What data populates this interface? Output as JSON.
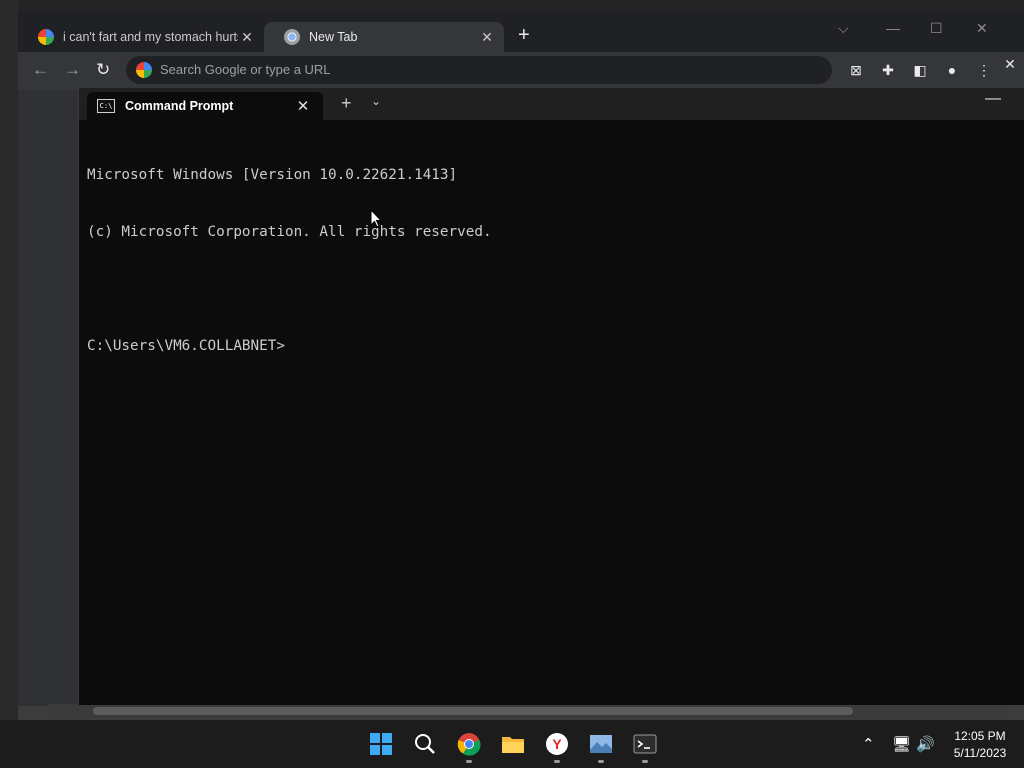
{
  "browser": {
    "tabs": [
      {
        "title": "i can't fart and my stomach hurts",
        "active": false
      },
      {
        "title": "New Tab",
        "active": true
      }
    ],
    "new_tab_symbol": "+",
    "omnibox_placeholder": "Search Google or type a URL"
  },
  "terminal": {
    "tab_title": "Command Prompt",
    "tab_icon_text": "C:\\",
    "lines": [
      "Microsoft Windows [Version 10.0.22621.1413]",
      "(c) Microsoft Corporation. All rights reserved.",
      "",
      "C:\\Users\\VM6.COLLABNET>"
    ]
  },
  "taskbar": {
    "icons": [
      "windows-start-icon",
      "search-icon",
      "chrome-icon",
      "file-explorer-icon",
      "yandex-icon",
      "photos-icon",
      "terminal-icon"
    ],
    "clock_time": "12:05 PM",
    "clock_date": "5/11/2023"
  },
  "colors": {
    "terminal_bg": "#0c0c0c",
    "terminal_text": "#cccccc",
    "chrome_frame": "#202124",
    "taskbar_bg": "#1c1c1c"
  }
}
